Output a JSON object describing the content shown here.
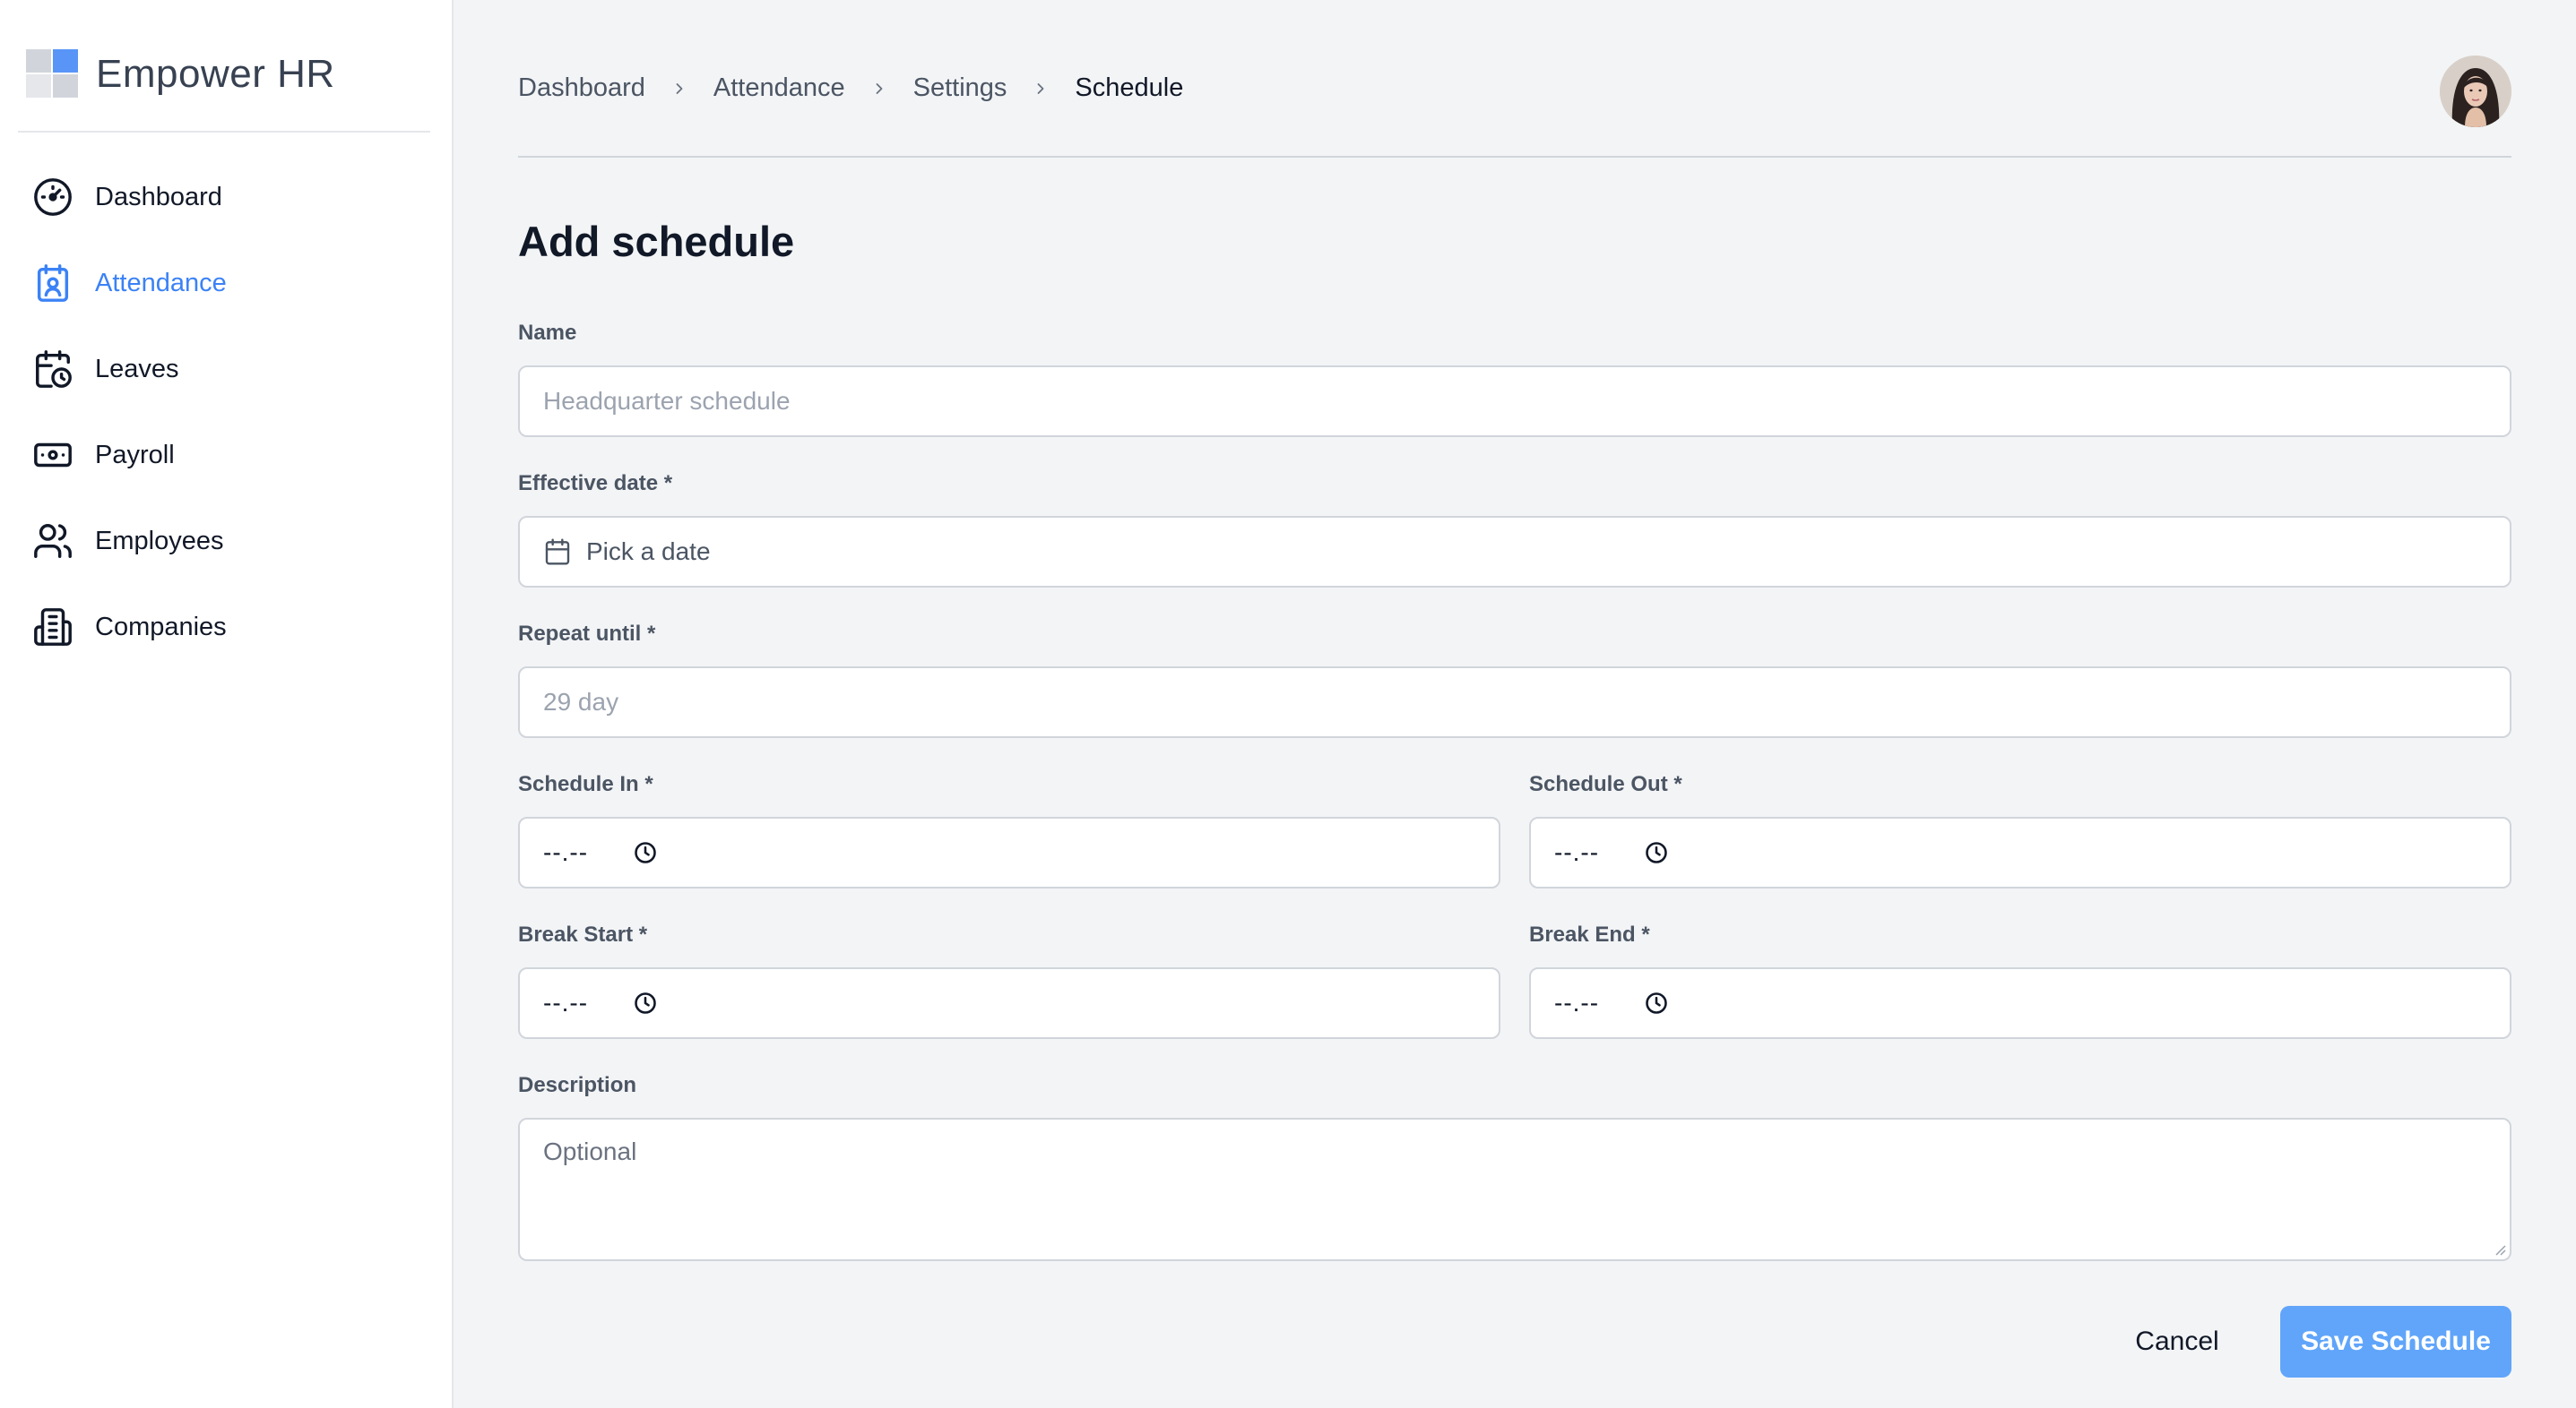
{
  "app": {
    "name": "Empower HR"
  },
  "sidebar": {
    "items": [
      {
        "label": "Dashboard",
        "icon": "gauge-icon",
        "active": false
      },
      {
        "label": "Attendance",
        "icon": "calendar-user-icon",
        "active": true
      },
      {
        "label": "Leaves",
        "icon": "calendar-clock-icon",
        "active": false
      },
      {
        "label": "Payroll",
        "icon": "banknote-icon",
        "active": false
      },
      {
        "label": "Employees",
        "icon": "users-icon",
        "active": false
      },
      {
        "label": "Companies",
        "icon": "building-icon",
        "active": false
      }
    ]
  },
  "breadcrumb": [
    "Dashboard",
    "Attendance",
    "Settings",
    "Schedule"
  ],
  "page": {
    "title": "Add schedule"
  },
  "form": {
    "name": {
      "label": "Name",
      "placeholder": "Headquarter schedule"
    },
    "effective_date": {
      "label": "Effective date *",
      "placeholder": "Pick a date"
    },
    "repeat_until": {
      "label": "Repeat until *",
      "placeholder": "29 day"
    },
    "schedule_in": {
      "label": "Schedule In *",
      "value": "--.--"
    },
    "schedule_out": {
      "label": "Schedule Out *",
      "value": "--.--"
    },
    "break_start": {
      "label": "Break Start *",
      "value": "--.--"
    },
    "break_end": {
      "label": "Break End *",
      "value": "--.--"
    },
    "description": {
      "label": "Description",
      "placeholder": "Optional"
    }
  },
  "actions": {
    "cancel": "Cancel",
    "save": "Save Schedule"
  },
  "colors": {
    "accent": "#3b82f6",
    "save_button": "#60a5fa",
    "background": "#f3f4f6"
  }
}
